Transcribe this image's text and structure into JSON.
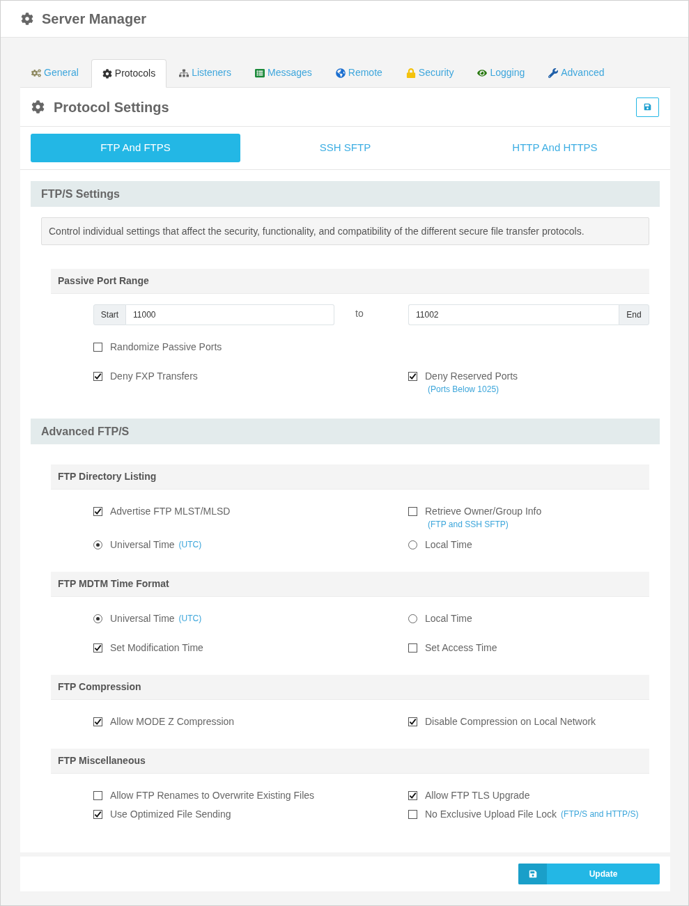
{
  "header": {
    "title": "Server Manager"
  },
  "tabs": [
    {
      "label": "General",
      "selected": false
    },
    {
      "label": "Protocols",
      "selected": true
    },
    {
      "label": "Listeners",
      "selected": false
    },
    {
      "label": "Messages",
      "selected": false
    },
    {
      "label": "Remote",
      "selected": false
    },
    {
      "label": "Security",
      "selected": false
    },
    {
      "label": "Logging",
      "selected": false
    },
    {
      "label": "Advanced",
      "selected": false
    }
  ],
  "panel": {
    "title": "Protocol Settings"
  },
  "protocol_tabs": [
    {
      "label": "FTP And FTPS",
      "selected": true
    },
    {
      "label": "SSH SFTP",
      "selected": false
    },
    {
      "label": "HTTP And HTTPS",
      "selected": false
    }
  ],
  "sections": [
    {
      "title": "FTP/S Settings",
      "description": "Control individual settings that affect the security, functionality, and compatibility of the different secure file transfer protocols.",
      "groups": [
        {
          "title": "Passive Port Range",
          "port_range": {
            "start": {
              "addon": "Start",
              "value": "11000"
            },
            "separator": "to",
            "end": {
              "value": "11002",
              "addon": "End"
            }
          },
          "rows": [
            {
              "columns": [
                [
                  {
                    "kind": "checkbox",
                    "label": "Randomize Passive Ports",
                    "checked": false
                  }
                ]
              ]
            },
            {
              "columns": [
                [
                  {
                    "kind": "checkbox",
                    "label": "Deny FXP Transfers",
                    "checked": true
                  }
                ],
                [
                  {
                    "kind": "checkbox",
                    "label": "Deny Reserved Ports",
                    "checked": true,
                    "note": "(Ports Below 1025)",
                    "note_below": true
                  }
                ]
              ]
            }
          ]
        }
      ]
    },
    {
      "title": "Advanced FTP/S",
      "groups": [
        {
          "title": "FTP Directory Listing",
          "rows": [
            {
              "columns": [
                [
                  {
                    "kind": "checkbox",
                    "label": "Advertise FTP MLST/MLSD",
                    "checked": true
                  }
                ],
                [
                  {
                    "kind": "checkbox",
                    "label": "Retrieve Owner/Group Info",
                    "checked": false,
                    "note": "(FTP and SSH SFTP)",
                    "note_below": true
                  }
                ]
              ]
            },
            {
              "columns": [
                [
                  {
                    "kind": "radio",
                    "label": "Universal Time",
                    "selected": true,
                    "note": "(UTC)",
                    "note_below": false
                  }
                ],
                [
                  {
                    "kind": "radio",
                    "label": "Local Time",
                    "selected": false
                  }
                ]
              ]
            }
          ]
        },
        {
          "title": "FTP MDTM Time Format",
          "rows": [
            {
              "columns": [
                [
                  {
                    "kind": "radio",
                    "label": "Universal Time",
                    "selected": true,
                    "note": "(UTC)",
                    "note_below": false
                  }
                ],
                [
                  {
                    "kind": "radio",
                    "label": "Local Time",
                    "selected": false
                  }
                ]
              ]
            },
            {
              "columns": [
                [
                  {
                    "kind": "checkbox",
                    "label": "Set Modification Time",
                    "checked": true
                  }
                ],
                [
                  {
                    "kind": "checkbox",
                    "label": "Set Access Time",
                    "checked": false
                  }
                ]
              ]
            }
          ]
        },
        {
          "title": "FTP Compression",
          "rows": [
            {
              "columns": [
                [
                  {
                    "kind": "checkbox",
                    "label": "Allow MODE Z Compression",
                    "checked": true
                  }
                ],
                [
                  {
                    "kind": "checkbox",
                    "label": "Disable Compression on Local Network",
                    "checked": true
                  }
                ]
              ]
            }
          ]
        },
        {
          "title": "FTP Miscellaneous",
          "rows": [
            {
              "columns": [
                [
                  {
                    "kind": "checkbox",
                    "label": "Allow FTP Renames to Overwrite Existing Files",
                    "checked": false
                  },
                  {
                    "kind": "checkbox",
                    "label": "Use Optimized File Sending",
                    "checked": true
                  }
                ],
                [
                  {
                    "kind": "checkbox",
                    "label": "Allow FTP TLS Upgrade",
                    "checked": true
                  },
                  {
                    "kind": "checkbox",
                    "label": "No Exclusive Upload File Lock",
                    "checked": false,
                    "note": "(FTP/S and HTTP/S)",
                    "note_below": false
                  }
                ]
              ]
            }
          ]
        }
      ]
    }
  ],
  "footer": {
    "button": "Update"
  }
}
